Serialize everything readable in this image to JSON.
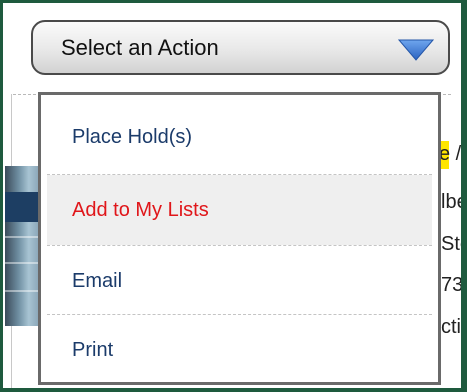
{
  "select": {
    "label": "Select an Action",
    "icon": "triangle-down-icon",
    "arrow_color": "#3b79d6"
  },
  "menu": {
    "items": [
      {
        "label": "Place Hold(s)",
        "state": "normal"
      },
      {
        "label": "Add to My Lists",
        "state": "hover"
      },
      {
        "label": "Email",
        "state": "normal"
      },
      {
        "label": "Print",
        "state": "normal"
      }
    ],
    "hover_color": "#e0161a",
    "text_color": "#1b3b6a"
  },
  "background_record": {
    "fragments": [
      "e /",
      "lbe",
      "Ste",
      "73",
      "ctio"
    ]
  },
  "colors": {
    "frame_border": "#1e5a3e",
    "highlight": "#ffe600"
  }
}
